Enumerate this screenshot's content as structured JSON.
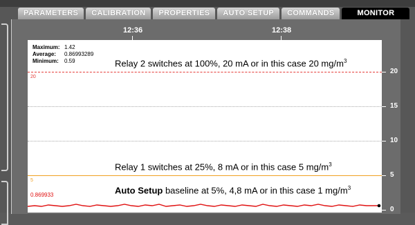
{
  "tabs": [
    {
      "label": "PARAMETERS"
    },
    {
      "label": "CALIBRATION"
    },
    {
      "label": "PROPERTIES"
    },
    {
      "label": "AUTO SETUP"
    },
    {
      "label": "COMMANDS"
    },
    {
      "label": "MONITOR",
      "active": true
    }
  ],
  "time_axis": {
    "labels": [
      "12:36",
      "12:38"
    ]
  },
  "right_axis": {
    "labels": [
      "20",
      "15",
      "10",
      "5",
      "0"
    ]
  },
  "stats": {
    "max_label": "Maximum:",
    "max_value": "1.42",
    "avg_label": "Average:",
    "avg_value": "0.86993289",
    "min_label": "Minimum:",
    "min_value": "0.59"
  },
  "lines": {
    "relay2": {
      "small_label": "20",
      "color": "#e53935",
      "annotation": "Relay 2 switches at 100%, 20 mA or in this case 20 mg/m",
      "superscript": "3"
    },
    "relay1": {
      "small_label": "5",
      "color": "#f0a020",
      "annotation": "Relay 1 switches at 25%, 8 mA or in this case 5 mg/m",
      "superscript": "3"
    },
    "baseline": {
      "small_label": "0.869933",
      "color": "#e01010",
      "annotation_bold": "Auto Setup",
      "annotation": " baseline at 5%, 4,8 mA or in this case 1 mg/m",
      "superscript": "3"
    }
  },
  "colors": {
    "background": "#575757",
    "panel": "#6c6c6c",
    "plot": "#ffffff",
    "active_tab": "#000000"
  }
}
